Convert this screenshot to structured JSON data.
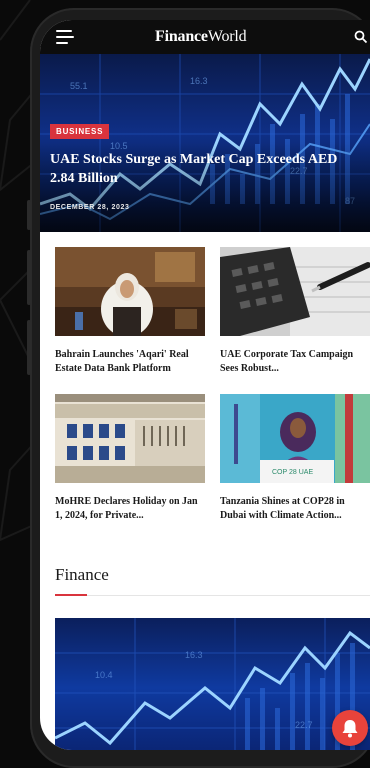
{
  "header": {
    "logo_bold": "Finance",
    "logo_light": "World",
    "menu_icon": "hamburger-menu-icon",
    "search_icon": "search-icon"
  },
  "hero": {
    "category": "BUSINESS",
    "title": "UAE Stocks Surge as Market Cap Exceeds AED 2.84 Billion",
    "date": "DECEMBER 28, 2023",
    "image": "stock-market-chart-image"
  },
  "articles": [
    {
      "title": "Bahrain Launches 'Aqari' Real Estate Data Bank Platform",
      "image": "officials-meeting-image"
    },
    {
      "title": "UAE Corporate Tax Campaign Sees Robust...",
      "image": "calculator-pen-image"
    },
    {
      "title": "MoHRE Declares Holiday on Jan 1, 2024, for Private...",
      "image": "government-building-image"
    },
    {
      "title": "Tanzania Shines at COP28 in Dubai with Climate Action...",
      "image": "speaker-podium-image"
    }
  ],
  "section": {
    "title": "Finance"
  },
  "fab": {
    "icon": "notification-bell-icon"
  },
  "colors": {
    "accent": "#d9343d",
    "header_bg": "#0d0d0d",
    "chart_blue": "#0f3aa0"
  }
}
